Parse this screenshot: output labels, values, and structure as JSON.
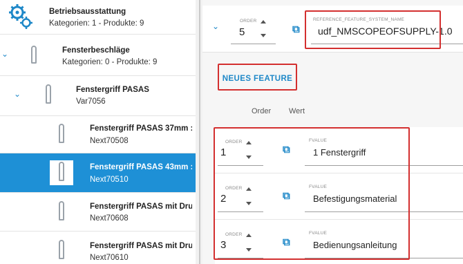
{
  "tree": {
    "items": [
      {
        "title": "Betriebsausstattung",
        "sub": "Kategorien: 1 - Produkte: 9"
      },
      {
        "title": "Fensterbeschläge",
        "sub": "Kategorien: 0 - Produkte: 9"
      },
      {
        "title": "Fenstergriff PASAS",
        "sub": "Var7056"
      },
      {
        "title": "Fenstergriff PASAS 37mm :",
        "sub": "Next70508"
      },
      {
        "title": "Fenstergriff PASAS 43mm :",
        "sub": "Next70510"
      },
      {
        "title": "Fenstergriff PASAS mit Dru",
        "sub": "Next70608"
      },
      {
        "title": "Fenstergriff PASAS mit Dru",
        "sub": "Next70610"
      }
    ]
  },
  "top": {
    "order_label": "ORDER",
    "order_value": "5",
    "ref_label": "REFERENCE_FEATURE_SYSTEM_NAME",
    "ref_value": "udf_NMSCOPEOFSUPPLY-1.0"
  },
  "new_feature_label": "NEUES FEATURE",
  "columns": {
    "order": "Order",
    "value": "Wert"
  },
  "features": [
    {
      "order_label": "ORDER",
      "order": "1",
      "fvalue_label": "FVALUE",
      "fvalue": "1 Fenstergriff"
    },
    {
      "order_label": "ORDER",
      "order": "2",
      "fvalue_label": "FVALUE",
      "fvalue": "Befestigungsmaterial"
    },
    {
      "order_label": "ORDER",
      "order": "3",
      "fvalue_label": "FVALUE",
      "fvalue": "Bedienungsanleitung"
    }
  ],
  "colors": {
    "accent": "#1e88c8",
    "selected": "#1e90d6",
    "highlight": "#d32f2f"
  },
  "icons": [
    "gears-icon",
    "chevron-down-icon",
    "link-icon",
    "window-handle-icon"
  ]
}
